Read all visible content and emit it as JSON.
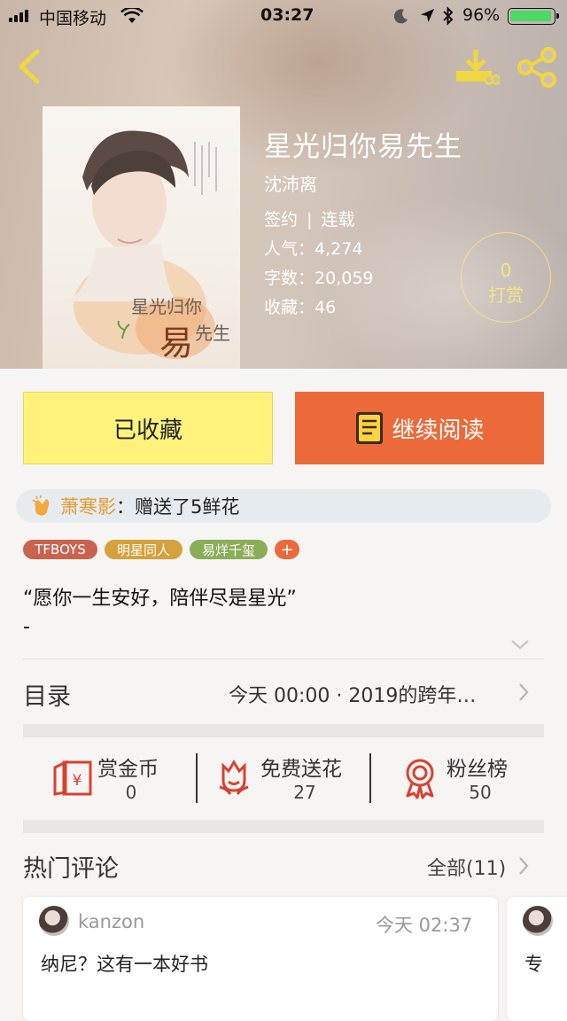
{
  "status_bar": {
    "carrier": "中国移动",
    "time": "03:27",
    "battery": "96%"
  },
  "book": {
    "title": "星光归你易先生",
    "author": "沈沛离",
    "contract": "签约",
    "contract_sep": "|",
    "status": "连载",
    "popularity_label": "人气：",
    "popularity": "4,274",
    "words_label": "字数：",
    "words": "20,059",
    "favorites_label": "收藏：",
    "favorites": "46",
    "cover_title_top": "星光归你",
    "cover_title_big": "易",
    "cover_title_end": "先生"
  },
  "reward": {
    "count": "0",
    "label": "打赏"
  },
  "actions": {
    "collected_label": "已收藏",
    "read_label": "继续阅读"
  },
  "gift": {
    "user": "萧寒影",
    "text": "：赠送了5鲜花"
  },
  "tags": [
    {
      "label": "TFBOYS",
      "color": "#c9634e"
    },
    {
      "label": "明星同人",
      "color": "#d5a13c"
    },
    {
      "label": "易烊千玺",
      "color": "#8aae58"
    },
    {
      "label": "+",
      "color": "#ea6a3d"
    }
  ],
  "intro": {
    "line1": "“愿你一生安好，陪伴尽是星光”",
    "line2": "-"
  },
  "toc": {
    "label": "目录",
    "latest": "今天 00:00 · 2019的跨年…"
  },
  "stats": [
    {
      "label": "赏金币",
      "value": "0",
      "icon": "red-envelope-icon"
    },
    {
      "label": "免费送花",
      "value": "27",
      "icon": "flower-icon"
    },
    {
      "label": "粉丝榜",
      "value": "50",
      "icon": "medal-icon"
    }
  ],
  "comments_section": {
    "title": "热门评论",
    "all_label": "全部(11)"
  },
  "comments": [
    {
      "user": "kanzon",
      "time": "今天 02:37",
      "text": "纳尼？这有一本好书"
    },
    {
      "user": "",
      "time": "",
      "text": "专"
    }
  ],
  "colors": {
    "accent_orange": "#ec6a3a",
    "collected_yellow": "#fff27b",
    "header_gold": "#f0d640"
  }
}
